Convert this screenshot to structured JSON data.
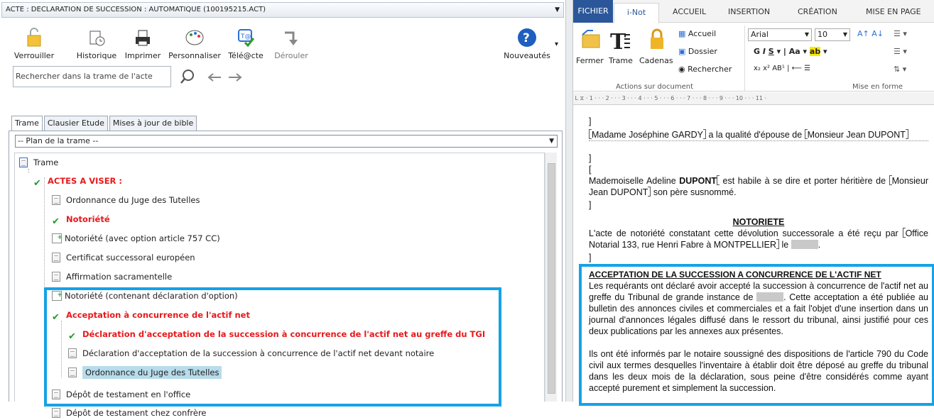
{
  "left": {
    "title": "ACTE : DECLARATION DE SUCCESSION : AUTOMATIQUE (100195215.ACT)",
    "toolbar": {
      "verrouiller": "Verrouiller",
      "historique": "Historique",
      "imprimer": "Imprimer",
      "personnaliser": "Personnaliser",
      "telacte": "Télé@cte",
      "derouler": "Dérouler",
      "nouveautes": "Nouveautés"
    },
    "search_placeholder": "Rechercher dans la trame de l'acte",
    "tabs": [
      "Trame",
      "Clausier Etude",
      "Mises à jour de bible"
    ],
    "plan": "-- Plan de la trame --",
    "tree": {
      "root": "Trame",
      "group1": "ACTES A VISER :",
      "items": [
        "Ordonnance du Juge des Tutelles",
        "Notoriété",
        "Notoriété (avec option article 757 CC)",
        "Certificat successoral européen",
        "Affirmation sacramentelle",
        "Notoriété (contenant déclaration d'option)",
        "Acceptation à concurrence de l'actif net",
        "Déclaration d'acceptation de la succession à concurrence de l'actif net au greffe du TGI",
        "Déclaration d'acceptation de la succession à concurrence de l'actif net devant notaire",
        "Ordonnance du Juge des Tutelles",
        "Dépôt de testament en l'office",
        "Dépôt de testament chez confrère"
      ]
    }
  },
  "right": {
    "tabs": [
      "FICHIER",
      "i-Not",
      "ACCUEIL",
      "INSERTION",
      "CRÉATION",
      "MISE EN PAGE"
    ],
    "ribbon": {
      "fermer": "Fermer",
      "trame": "Trame",
      "cadenas": "Cadenas",
      "accueil": "Accueil",
      "dossier": "Dossier",
      "rechercher": "Rechercher",
      "group_actions": "Actions sur document",
      "font": "Arial",
      "size": "10",
      "group_mise": "Mise en forme"
    },
    "doc": {
      "p1a": "Madame Joséphine GARDY",
      "p1b": " a la qualité d'épouse de ",
      "p1c": "Monsieur Jean DUPONT",
      "p2a": "Mademoiselle Adeline ",
      "p2b": "DUPONT",
      "p2c": " est habile à se dire et porter héritière de ",
      "p2d": "Monsieur Jean DUPONT",
      "p2e": " son père susnommé.",
      "h_notoriete": "NOTORIETE",
      "p3a": "L'acte de notoriété constatant cette dévolution successorale a été reçu par ",
      "p3b": "Office Notarial 133, rue Henri Fabre à MONTPELLIER",
      "p3c": " le ",
      "h_accept": "ACCEPTATION DE LA SUCCESSION A CONCURRENCE DE L'ACTIF NET",
      "p4a": "Les requérants ont déclaré avoir accepté la succession à concurrence de l'actif net au greffe du Tribunal de grande instance de ",
      "p4b": ". Cette acceptation a été publiée au bulletin des annonces civiles et commerciales et a fait l'objet d'une insertion dans un journal d'annonces légales diffusé dans le ressort du tribunal, ainsi justifié pour ces deux publications par les annexes aux présentes.",
      "p5": "Ils ont été informés par le notaire soussigné des dispositions de l'article 790 du Code civil aux termes desquelles l'inventaire à établir doit être déposé au greffe du tribunal dans les deux mois de la déclaration, sous peine d'être considérés comme ayant accepté purement et simplement la succession."
    }
  }
}
